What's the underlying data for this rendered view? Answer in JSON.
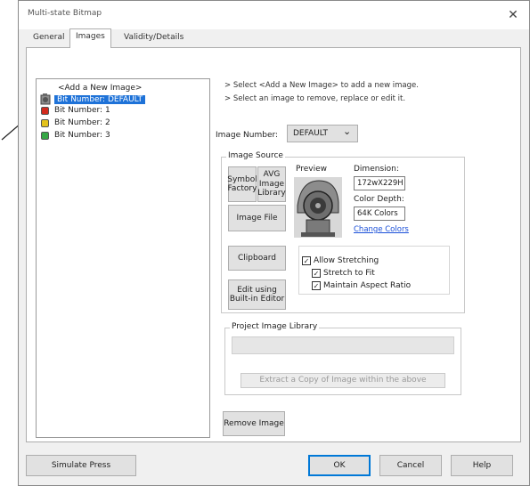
{
  "window": {
    "title": "Multi-state Bitmap",
    "close_glyph": "✕"
  },
  "tabs": [
    {
      "label": "General",
      "active": false
    },
    {
      "label": "Images",
      "active": true
    },
    {
      "label": "Validity/Details",
      "active": false
    }
  ],
  "image_list": {
    "items": [
      {
        "label": "<Add a New Image>",
        "icon": null,
        "selected": false
      },
      {
        "label": "Bit Number: DEFAULT",
        "icon": "motor-image-icon",
        "selected": true
      },
      {
        "label": "Bit Number: 1",
        "icon": "red-image-icon",
        "icon_color": "#d22a1e",
        "selected": false
      },
      {
        "label": "Bit Number: 2",
        "icon": "yellow-image-icon",
        "icon_color": "#e3c21b",
        "selected": false
      },
      {
        "label": "Bit Number: 3",
        "icon": "green-image-icon",
        "icon_color": "#36a845",
        "selected": false
      }
    ]
  },
  "hints": {
    "line1": "> Select <Add a New Image> to add a new image.",
    "line2": "> Select an image to remove, replace or edit it."
  },
  "image_number": {
    "label": "Image Number:",
    "value": "DEFAULT",
    "dropdown_glyph": "⌄"
  },
  "image_source": {
    "group_label": "Image Source",
    "symbol_factory": "Symbol Factory",
    "avg_library": "AVG Image Library",
    "image_file": "Image File",
    "clipboard": "Clipboard",
    "edit_builtin": "Edit using Built-in Editor",
    "preview_label": "Preview",
    "dimension_label": "Dimension:",
    "dimension_value": "172wX229H",
    "color_depth_label": "Color Depth:",
    "color_depth_value": "64K Colors",
    "change_colors": "Change Colors",
    "allow_stretching": "Allow Stretching",
    "stretch_to_fit": "Stretch to Fit",
    "maintain_aspect": "Maintain Aspect Ratio"
  },
  "project_library": {
    "group_label": "Project Image Library",
    "select_value": "",
    "extract_button": "Extract a Copy of Image within the above"
  },
  "remove_image": "Remove Image",
  "footer": {
    "simulate": "Simulate Press",
    "ok": "OK",
    "cancel": "Cancel",
    "help": "Help"
  },
  "colors": {
    "selection": "#1e72d8",
    "link": "#1a4fd8"
  }
}
